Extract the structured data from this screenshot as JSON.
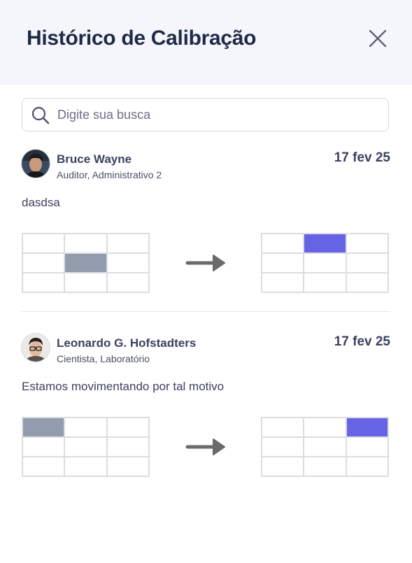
{
  "header": {
    "title": "Histórico de Calibração",
    "close_icon": "close-icon"
  },
  "search": {
    "placeholder": "Digite sua busca",
    "value": "",
    "icon": "search-icon"
  },
  "entries": [
    {
      "name": "Bruce Wayne",
      "role": "Auditor, Administrativo 2",
      "date": "17 fev 25",
      "comment": "dasdsa",
      "from_cell": {
        "row": 2,
        "col": 2
      },
      "to_cell": {
        "row": 1,
        "col": 2
      }
    },
    {
      "name": "Leonardo G. Hofstadters",
      "role": "Cientista, Laboratório",
      "date": "17 fev 25",
      "comment": "Estamos movimentando por tal motivo",
      "from_cell": {
        "row": 1,
        "col": 1
      },
      "to_cell": {
        "row": 1,
        "col": 3
      }
    }
  ],
  "colors": {
    "from_cell": "#929cad",
    "to_cell": "#6663e5",
    "arrow": "#6b6b6b",
    "header_bg": "#f5f6fb"
  }
}
